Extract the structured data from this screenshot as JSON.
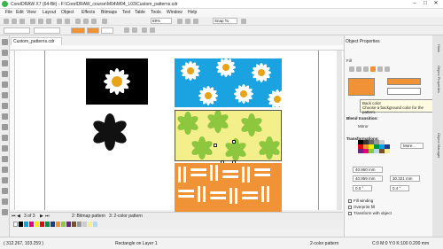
{
  "window": {
    "title": "CorelDRAW X7 (64-Bit) - F:\\CorelDRAW_course\\M04\\M04_L03\\Custom_patterns.cdr",
    "min": "–",
    "max": "□",
    "close": "✕"
  },
  "menu": [
    "File",
    "Edit",
    "View",
    "Layout",
    "Object",
    "Effects",
    "Bitmaps",
    "Text",
    "Table",
    "Tools",
    "Window",
    "Help"
  ],
  "toolbar": {
    "zoom": "69%",
    "snap": "Snap To"
  },
  "document_tab": "Custom_patterns.cdr",
  "pagebar": {
    "pages": "3 of 3",
    "page2": "2: Bitmap pattern",
    "page3": "3: 2-color pattern"
  },
  "status": {
    "coords": "( 312.267, 103.259 )",
    "object": "Rectangle on Layer 1",
    "fill_label": "2-color pattern",
    "outline": "C:0 M:0 Y:0 K:100  0.200 mm"
  },
  "panel": {
    "title": "Object Properties",
    "fill_label": "Fill",
    "tooltip_title": "Back color",
    "tooltip_text": "Choose a background color for the pattern.",
    "blend_label": "Blend transition:",
    "mirror_label": "Mirror",
    "transform_label": "Transformations:",
    "w": "40.950 mm",
    "h": "40.959 mm",
    "x": "30.321 mm",
    "angle1": "0.0 °",
    "angle2": "0.4 °",
    "more": "More...",
    "fill_winding": "Fill winding",
    "overprint": "Overprint fill",
    "transform_with": "Transform with object"
  },
  "sidebar_tabs": [
    "Hints",
    "Object Properties",
    "Object Manager"
  ],
  "colors": {
    "accent": "#f0862a",
    "blue": "#1aa3e0",
    "green": "#8dc63f",
    "yellow": "#f3f08c"
  }
}
